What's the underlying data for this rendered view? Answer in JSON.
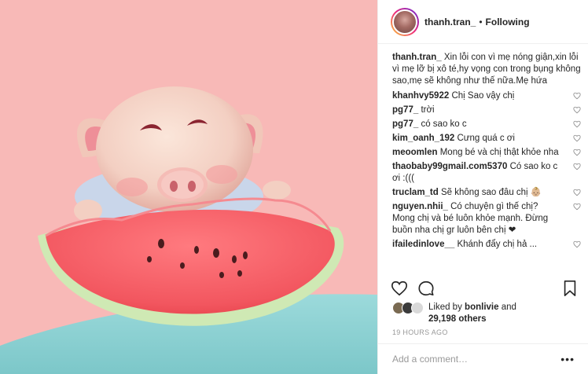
{
  "header": {
    "username": "thanh.tran_",
    "separator": "•",
    "follow_label": "Following"
  },
  "caption": {
    "username": "thanh.tran_",
    "text": "Xin lỗi con vì mẹ nóng giận,xin lỗi vì mẹ lỡ bị xô té,hy vọng con trong bụng không sao,mẹ sẽ không như thế nữa.Mẹ hứa"
  },
  "comments": [
    {
      "user": "khanhvy5922",
      "text": "Chị Sao vậy chị"
    },
    {
      "user": "pg77_",
      "text": "trời"
    },
    {
      "user": "pg77_",
      "text": "có sao ko c"
    },
    {
      "user": "kim_oanh_192",
      "text": "Cưng quá c ơi"
    },
    {
      "user": "meoomlen",
      "text": "Mong bé và chị thật khỏe nha"
    },
    {
      "user": "thaobaby99gmail.com5370",
      "text": "Có sao ko c ơi :((("
    },
    {
      "user": "truclam_td",
      "text": "Sẽ không sao đâu chị 👶🏼"
    },
    {
      "user": "nguyen.nhii_",
      "text": "Có chuyện gì thế chị? Mong chị và bé luôn khỏe mạnh. Đừng buồn nha chị gr luôn bên chị ❤"
    },
    {
      "user": "ifailedinlove__",
      "text": "Khánh đẩy chị hả ..."
    }
  ],
  "icons": {
    "like": "heart-icon",
    "comment": "comment-icon",
    "save": "bookmark-icon",
    "comment_like": "heart-icon",
    "more": "more-icon"
  },
  "likes": {
    "prefix": "Liked by",
    "user": "bonlivie",
    "middle": "and",
    "count": "29,198 others"
  },
  "timestamp": "19 HOURS AGO",
  "add_comment": {
    "placeholder": "Add a comment…",
    "more": "•••"
  },
  "colors": {
    "background_pink": "#f8b9b7",
    "teal_surface": "#8fd3d5",
    "watermelon_red": "#f05b63",
    "rind_green": "#cfe9b4"
  }
}
